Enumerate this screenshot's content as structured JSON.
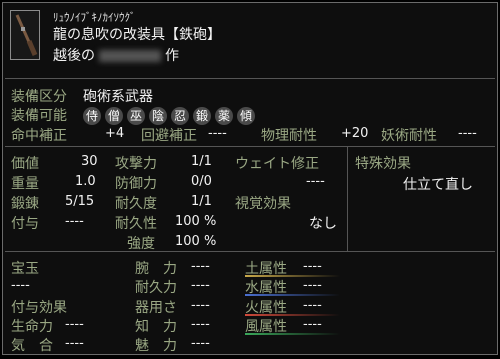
{
  "header": {
    "reading": "ﾘｭｳﾉｲﾌﾞｷﾉｶｲｿｳｸﾞ",
    "name": "龍の息吹の改装具【鉄砲】",
    "maker_prefix": "越後の",
    "maker_suffix": "作",
    "icon": "rifle-icon"
  },
  "class_row": {
    "label": "装備区分",
    "value": "砲術系武器"
  },
  "equip_row": {
    "label": "装備可能",
    "jobs": [
      "侍",
      "僧",
      "巫",
      "陰",
      "忍",
      "鍛",
      "薬",
      "傾"
    ]
  },
  "correction_row": {
    "hit_label": "命中補正",
    "hit_value": "+4",
    "evade_label": "回避補正",
    "evade_value": "----",
    "phys_label": "物理耐性",
    "phys_value": "+20",
    "magic_label": "妖術耐性",
    "magic_value": "----"
  },
  "stats": {
    "price_label": "価値",
    "price_value": "30",
    "weight_label": "重量",
    "weight_value": "1.0",
    "forge_label": "鍛錬",
    "forge_value": "5/15",
    "grant_label": "付与",
    "grant_value": "----",
    "atk_label": "攻撃力",
    "atk_value": "1/1",
    "def_label": "防御力",
    "def_value": "0/0",
    "dur_label": "耐久度",
    "dur_value": "1/1",
    "durres_label": "耐久性",
    "durres_value": "100 %",
    "str_label": "強度",
    "str_value": "100 %",
    "wmod_label": "ウェイト修正",
    "wmod_value": "----",
    "visual_label": "視覚効果",
    "visual_value": "なし"
  },
  "special": {
    "label": "特殊効果",
    "value": "仕立て直し"
  },
  "lower": {
    "gem_label": "宝玉",
    "gem_value": "----",
    "effect_label": "付与効果",
    "hp_label": "生命力",
    "hp_value": "----",
    "ki_label": "気　合",
    "ki_value": "----",
    "arm_label": "腕　力",
    "arm_value": "----",
    "end_label": "耐久力",
    "end_value": "----",
    "dex_label": "器用さ",
    "dex_value": "----",
    "int_label": "知　力",
    "int_value": "----",
    "cha_label": "魅　力",
    "cha_value": "----",
    "earth_label": "土属性",
    "earth_value": "----",
    "water_label": "水属性",
    "water_value": "----",
    "fire_label": "火属性",
    "fire_value": "----",
    "wind_label": "風属性",
    "wind_value": "----"
  },
  "colors": {
    "label": "#9aa884",
    "earth": "#c8a84a",
    "water": "#4a6fd0",
    "fire": "#d04a3a",
    "wind": "#3aa85a"
  }
}
